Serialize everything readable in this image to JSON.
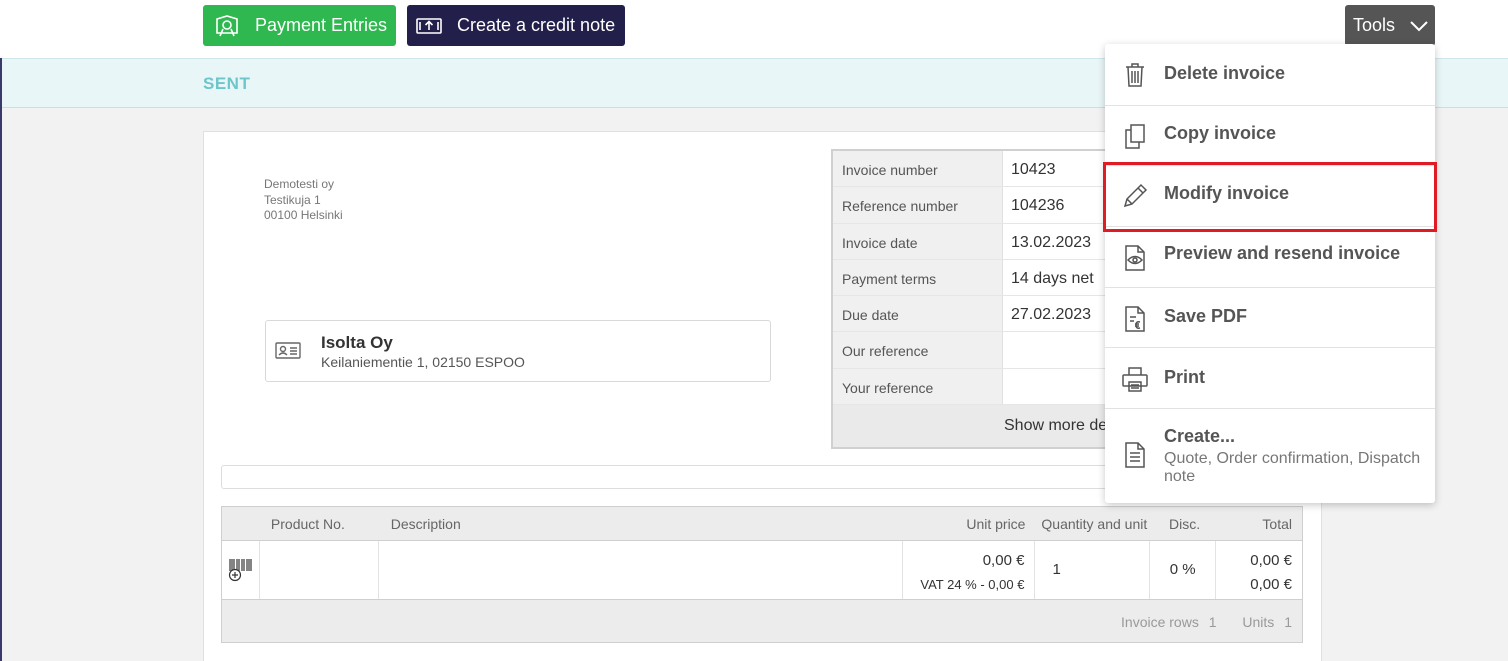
{
  "toolbar": {
    "payment_label": "Payment Entries",
    "credit_label": "Create a credit note",
    "tools_label": "Tools"
  },
  "status": {
    "label": "SENT"
  },
  "sender": {
    "name": "Demotesti oy",
    "street": "Testikuja 1",
    "city": "00100 Helsinki"
  },
  "recipient": {
    "name": "Isolta Oy",
    "address": "Keilaniementie 1, 02150 ESPOO"
  },
  "invoice_info": {
    "rows": [
      {
        "label": "Invoice number",
        "value": "10423"
      },
      {
        "label": "Reference number",
        "value": "104236"
      },
      {
        "label": "Invoice date",
        "value": "13.02.2023"
      },
      {
        "label": "Payment terms",
        "value": "14 days net"
      },
      {
        "label": "Due date",
        "value": "27.02.2023"
      },
      {
        "label": "Our reference",
        "value": ""
      },
      {
        "label": "Your reference",
        "value": ""
      }
    ],
    "show_more_label": "Show more de"
  },
  "rows_table": {
    "headers": {
      "product_no": "Product No.",
      "description": "Description",
      "unit_price": "Unit price",
      "quantity": "Quantity and unit",
      "disc": "Disc.",
      "total": "Total"
    },
    "row": {
      "unit_price": "0,00 €",
      "vat": "VAT 24 % - 0,00 €",
      "quantity": "1",
      "disc": "0 %",
      "total": "0,00 €",
      "total_vat": "0,00 €"
    },
    "footer": {
      "rows_label": "Invoice rows",
      "rows_value": "1",
      "units_label": "Units",
      "units_value": "1"
    }
  },
  "tools_menu": {
    "items": [
      {
        "label": "Delete invoice",
        "icon": "trash-icon"
      },
      {
        "label": "Copy invoice",
        "icon": "copy-icon"
      },
      {
        "label": "Modify invoice",
        "icon": "pencil-icon"
      },
      {
        "label": "Preview and resend invoice",
        "icon": "preview-icon"
      },
      {
        "label": "Save PDF",
        "icon": "pdf-icon"
      },
      {
        "label": "Print",
        "icon": "printer-icon"
      },
      {
        "label": "Create...",
        "icon": "document-icon",
        "sub": "Quote, Order confirmation, Dispatch note"
      }
    ]
  },
  "colors": {
    "payment_button": "#2fb84f",
    "credit_button": "#22204a",
    "status_text": "#6cc6ca",
    "highlight": "#e01b24"
  }
}
